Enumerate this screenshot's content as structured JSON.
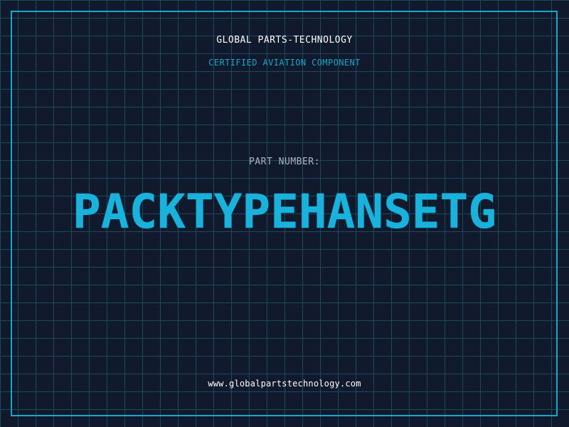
{
  "header": {
    "company": "GLOBAL PARTS-TECHNOLOGY",
    "tagline": "CERTIFIED AVIATION COMPONENT"
  },
  "part": {
    "label": "PART NUMBER:",
    "number": "PACKTYPEHANSETG"
  },
  "footer": {
    "website": "www.globalpartstechnology.com"
  },
  "colors": {
    "background": "#111a2d",
    "grid": "#1b4a5c",
    "accent": "#18a6c9",
    "part_number": "#18b2dc",
    "text": "#ffffff",
    "muted": "#a9b4c4"
  }
}
